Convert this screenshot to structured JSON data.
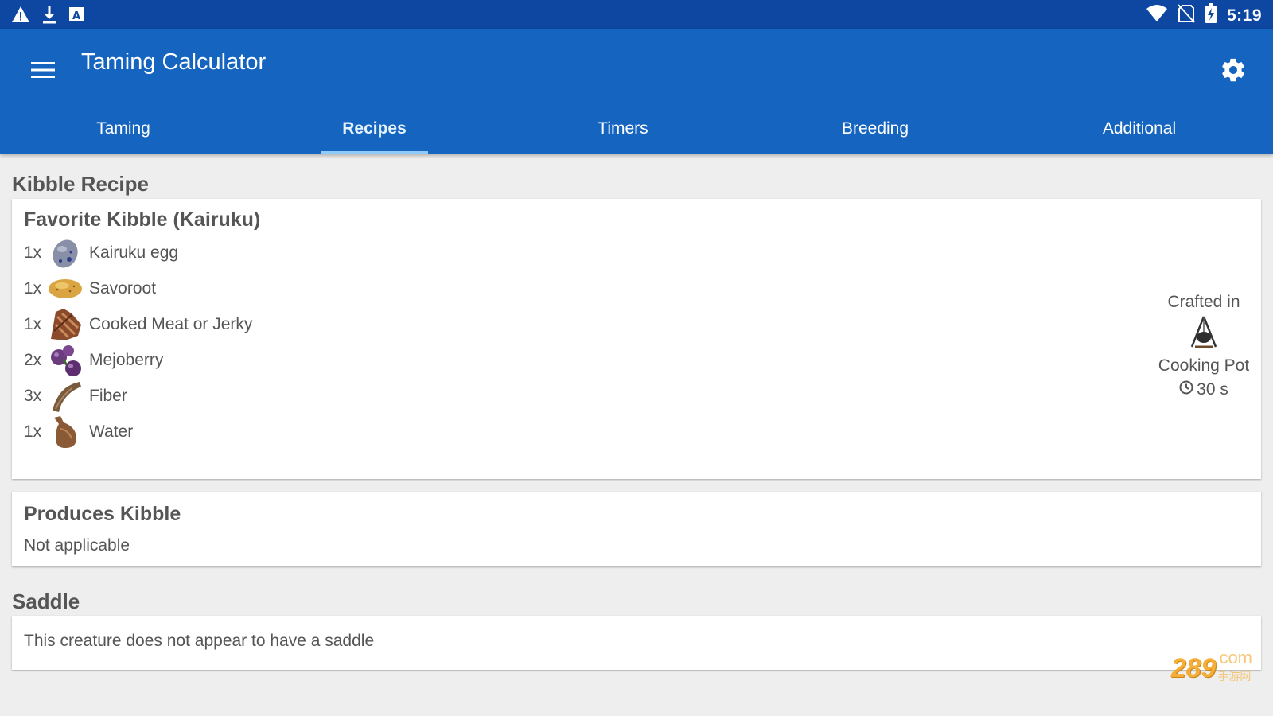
{
  "status_bar": {
    "time": "5:19",
    "left_icons": [
      "warning-icon",
      "download-icon",
      "a-icon"
    ],
    "right_icons": [
      "wifi-icon",
      "no-sim-icon",
      "battery-icon"
    ]
  },
  "app_bar": {
    "title": "Taming Calculator",
    "menu_icon": "menu-icon",
    "settings_icon": "gear-icon",
    "color": "#1565c0"
  },
  "tabs": [
    {
      "label": "Taming",
      "active": false
    },
    {
      "label": "Recipes",
      "active": true
    },
    {
      "label": "Timers",
      "active": false
    },
    {
      "label": "Breeding",
      "active": false
    },
    {
      "label": "Additional",
      "active": false
    }
  ],
  "kibble_recipe": {
    "section_title": "Kibble Recipe",
    "card_title": "Favorite Kibble (Kairuku)",
    "ingredients": [
      {
        "qty": "1x",
        "name": "Kairuku egg",
        "icon": "egg-icon"
      },
      {
        "qty": "1x",
        "name": "Savoroot",
        "icon": "savoroot-icon"
      },
      {
        "qty": "1x",
        "name": "Cooked Meat or Jerky",
        "icon": "cooked-meat-icon"
      },
      {
        "qty": "2x",
        "name": "Mejoberry",
        "icon": "mejoberry-icon"
      },
      {
        "qty": "3x",
        "name": "Fiber",
        "icon": "fiber-icon"
      },
      {
        "qty": "1x",
        "name": "Water",
        "icon": "waterskin-icon"
      }
    ],
    "crafted_label": "Crafted in",
    "station": "Cooking Pot",
    "station_icon": "cooking-pot-icon",
    "time_icon": "clock-icon",
    "time": "30 s"
  },
  "produces_kibble": {
    "title": "Produces Kibble",
    "value": "Not applicable"
  },
  "saddle": {
    "section_title": "Saddle",
    "text": "This creature does not appear to have a saddle"
  },
  "watermark": {
    "number": "289",
    "suffix": "com",
    "sub": "手游网"
  }
}
